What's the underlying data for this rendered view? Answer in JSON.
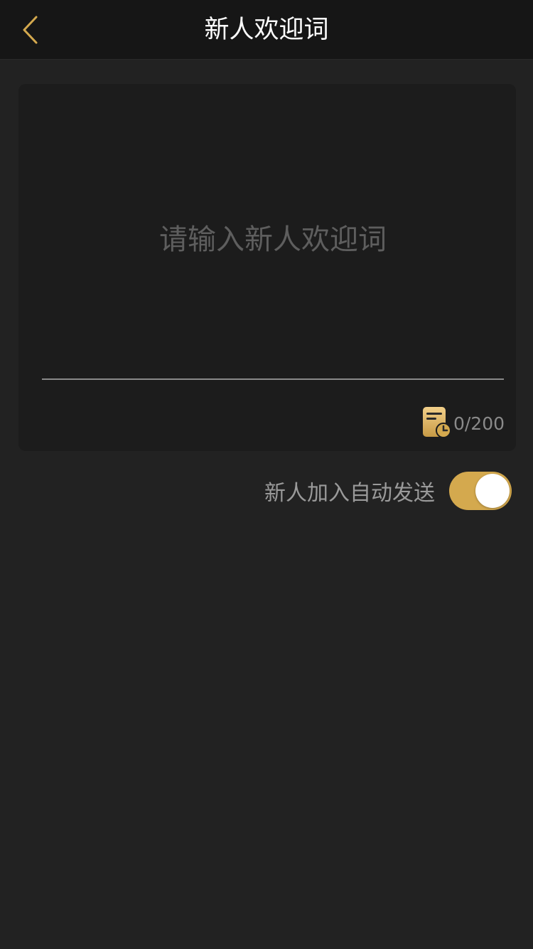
{
  "header": {
    "title": "新人欢迎词",
    "back_icon": "chevron-left-icon"
  },
  "editor": {
    "placeholder": "请输入新人欢迎词",
    "value": "",
    "char_count": "0/200",
    "template_icon": "document-clock-icon"
  },
  "auto_send": {
    "label": "新人加入自动发送",
    "enabled": true
  },
  "colors": {
    "background": "#222222",
    "navbar": "#161616",
    "card": "#1c1c1c",
    "accent": "#d4a94e"
  }
}
